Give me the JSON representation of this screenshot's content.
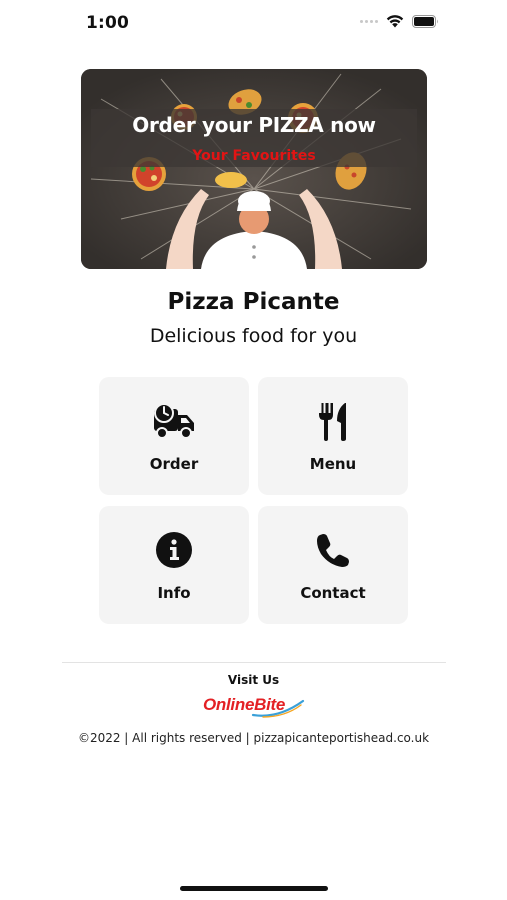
{
  "status_bar": {
    "time": "1:00",
    "icons": [
      "cellular-signal-icon",
      "wifi-icon",
      "battery-icon"
    ]
  },
  "banner": {
    "title": "Order your PIZZA now",
    "subtitle": "Your Favourites",
    "title_color": "#ffffff",
    "subtitle_color": "#e21414"
  },
  "restaurant": {
    "name": "Pizza Picante",
    "tagline": "Delicious food for you"
  },
  "tiles": [
    {
      "label": "Order",
      "icon": "delivery-truck-icon"
    },
    {
      "label": "Menu",
      "icon": "fork-knife-icon"
    },
    {
      "label": "Info",
      "icon": "info-icon"
    },
    {
      "label": "Contact",
      "icon": "phone-icon"
    }
  ],
  "footer": {
    "visit_label": "Visit Us",
    "brand_name": "OnlineBite",
    "copyright": "©2022 | All rights reserved | pizzapicanteportishead.co.uk"
  },
  "colors": {
    "tile_bg": "#f4f4f4",
    "brand_red": "#e32024",
    "brand_swoosh": "#3aa0d8"
  }
}
